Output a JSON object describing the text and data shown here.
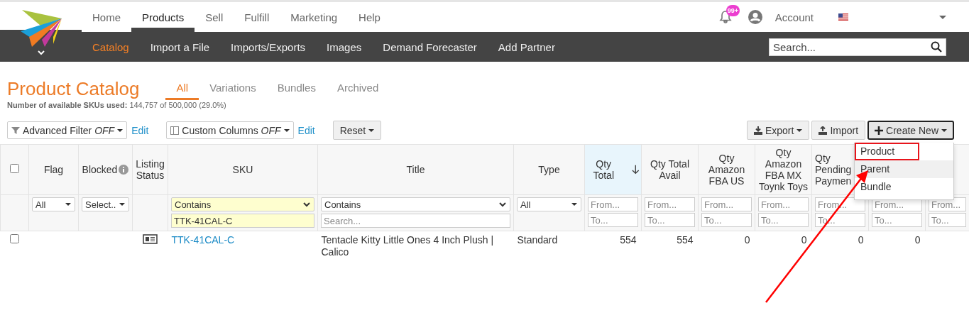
{
  "header": {
    "nav": [
      {
        "label": "Home",
        "selected": false
      },
      {
        "label": "Products",
        "selected": true
      },
      {
        "label": "Sell",
        "selected": false
      },
      {
        "label": "Fulfill",
        "selected": false
      },
      {
        "label": "Marketing",
        "selected": false
      },
      {
        "label": "Help",
        "selected": false
      }
    ],
    "notification_badge": "99+",
    "account": "Account",
    "subnav": [
      {
        "label": "Catalog",
        "selected": true
      },
      {
        "label": "Import a File",
        "selected": false
      },
      {
        "label": "Imports/Exports",
        "selected": false
      },
      {
        "label": "Images",
        "selected": false
      },
      {
        "label": "Demand Forecaster",
        "selected": false
      },
      {
        "label": "Add Partner",
        "selected": false
      }
    ],
    "search": {
      "placeholder": "Search..."
    }
  },
  "page": {
    "title": "Product Catalog",
    "tabs": [
      {
        "label": "All",
        "selected": true
      },
      {
        "label": "Variations",
        "selected": false
      },
      {
        "label": "Bundles",
        "selected": false
      },
      {
        "label": "Archived",
        "selected": false
      }
    ],
    "usage": "**Number of available SKUs used:** 144,757 of 500,000 (29.0%)"
  },
  "toolbar": {
    "filters": [
      {
        "kind": "filter",
        "label": "Advanced Filter *OFF*",
        "link": "Edit"
      },
      {
        "kind": "columns",
        "label": "Custom Columns *OFF*",
        "link": "Edit"
      }
    ],
    "reset": "Reset",
    "actions": [
      {
        "kind": "export",
        "label": "Export",
        "caret": true,
        "active": false
      },
      {
        "kind": "import",
        "label": "Import",
        "caret": false,
        "active": false
      },
      {
        "kind": "create",
        "label": "Create New",
        "caret": true,
        "active": true
      }
    ]
  },
  "table": {
    "all_checked": false,
    "columns": [
      {
        "kind": "checkbox",
        "filter": {
          "kind": "none"
        }
      },
      {
        "kind": "text",
        "label": "Flag",
        "info": false,
        "sorted": false,
        "filter": {
          "kind": "select",
          "value": "All"
        }
      },
      {
        "kind": "text",
        "label": "Blocked",
        "info": true,
        "sorted": false,
        "filter": {
          "kind": "select",
          "value": "Select.."
        }
      },
      {
        "kind": "text",
        "label": "Listing Status",
        "info": false,
        "sorted": false,
        "filter": {
          "kind": "none"
        }
      },
      {
        "kind": "text",
        "label": "SKU",
        "info": false,
        "sorted": false,
        "filter": {
          "kind": "match",
          "value": "Contains",
          "query": "TTK-41CAL-C",
          "highlighted": true
        }
      },
      {
        "kind": "text",
        "label": "Title",
        "info": false,
        "sorted": false,
        "filter": {
          "kind": "match",
          "value": "Contains",
          "placeholder": "Search...",
          "highlighted": false
        }
      },
      {
        "kind": "text",
        "label": "Type",
        "info": false,
        "sorted": false,
        "filter": {
          "kind": "select",
          "value": "All"
        }
      },
      {
        "kind": "text",
        "label": "Qty Total",
        "info": false,
        "sorted": true,
        "filter": {
          "kind": "range",
          "from": {
            "placeholder": "From..."
          },
          "to": {
            "placeholder": "To..."
          }
        }
      },
      {
        "kind": "text",
        "label": "Qty Total Avail",
        "info": false,
        "sorted": false,
        "filter": {
          "kind": "range",
          "from": {
            "placeholder": "From..."
          },
          "to": {
            "placeholder": "To..."
          }
        }
      },
      {
        "kind": "text",
        "label": "Qty Amazon FBA US",
        "info": false,
        "sorted": false,
        "filter": {
          "kind": "range",
          "from": {
            "placeholder": "From..."
          },
          "to": {
            "placeholder": "To..."
          }
        }
      },
      {
        "kind": "text",
        "label": "Qty Amazon FBA MX Toynk Toys",
        "info": false,
        "sorted": false,
        "filter": {
          "kind": "range",
          "from": {
            "placeholder": "From..."
          },
          "to": {
            "placeholder": "To..."
          }
        }
      },
      {
        "kind": "text",
        "label": "Qty Pending Paymen",
        "info": false,
        "sorted": false,
        "filter": {
          "kind": "range",
          "from": {
            "placeholder": "From..."
          },
          "to": {
            "placeholder": "To..."
          }
        }
      },
      {
        "kind": "covered",
        "filter": {
          "kind": "range",
          "from": {
            "placeholder": "From..."
          },
          "to": {
            "placeholder": "To..."
          }
        }
      },
      {
        "kind": "covered",
        "filter": {
          "kind": "range",
          "from": {
            "placeholder": "From..."
          },
          "to": {
            "placeholder": "To..."
          }
        }
      }
    ],
    "rows": [
      {
        "checked": false,
        "listing_icon": true,
        "sku": "TTK-41CAL-C",
        "title": "Tentacle Kitty Little Ones 4 Inch Plush | Calico",
        "type": "Standard",
        "quantities": [
          "554",
          "554",
          "0",
          "0",
          "0",
          "0"
        ]
      }
    ]
  },
  "menu": {
    "items": [
      {
        "label": "Product",
        "hovered": false,
        "outlined": true
      },
      {
        "label": "Parent",
        "hovered": true,
        "outlined": false
      },
      {
        "label": "Bundle",
        "hovered": false,
        "outlined": false
      }
    ]
  },
  "annotation": {
    "arrow": true
  }
}
